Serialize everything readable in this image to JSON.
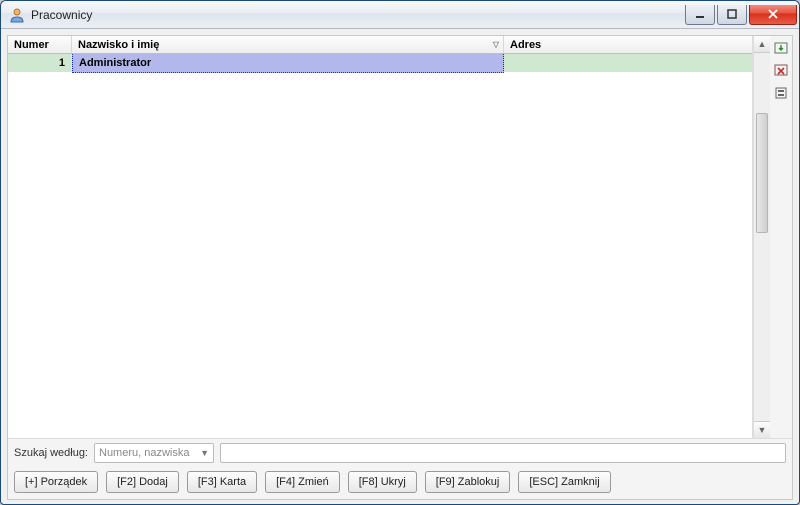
{
  "window": {
    "title": "Pracownicy"
  },
  "grid": {
    "columns": {
      "numer": "Numer",
      "nazwisko": "Nazwisko i imię",
      "adres": "Adres"
    },
    "sort_indicator": "▽",
    "rows": [
      {
        "numer": "1",
        "nazwisko": "Administrator",
        "adres": ""
      }
    ]
  },
  "search": {
    "label": "Szukaj według:",
    "combo_value": "Numeru, nazwiska",
    "input_value": ""
  },
  "buttons": {
    "porzadek": "[+] Porządek",
    "dodaj": "[F2] Dodaj",
    "karta": "[F3] Karta",
    "zmien": "[F4] Zmień",
    "ukryj": "[F8] Ukryj",
    "zablokuj": "[F9] Zablokuj",
    "zamknij": "[ESC] Zamknij"
  }
}
